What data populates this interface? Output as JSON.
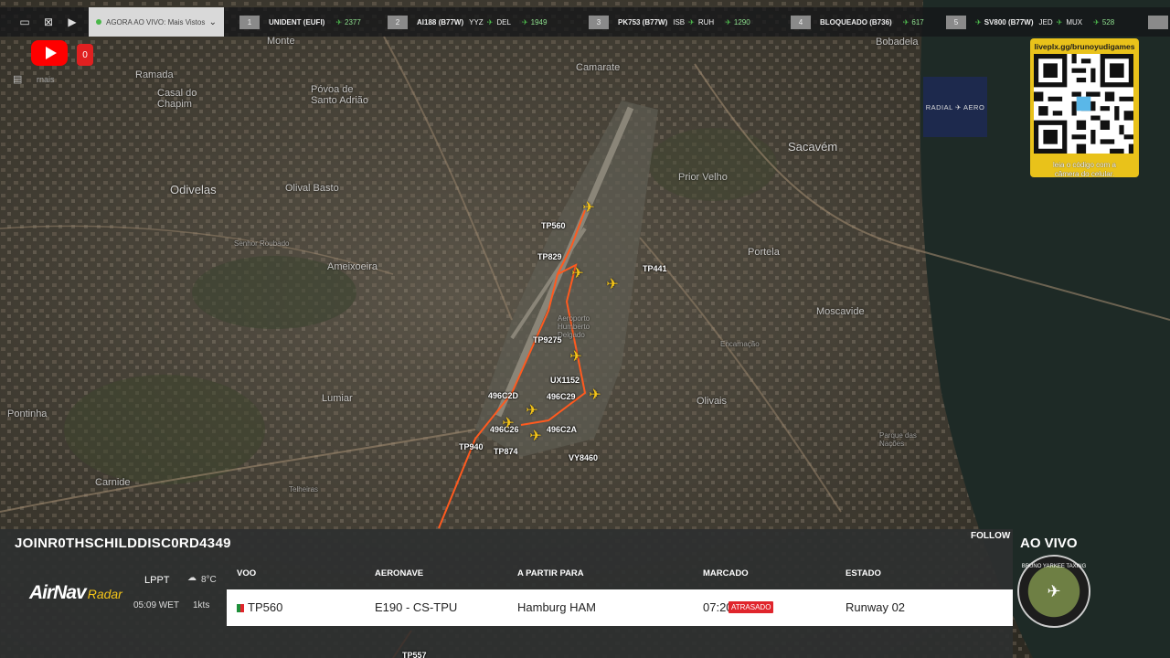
{
  "topbar": {
    "live_select_label": "AGORA AO VIVO: Mais Vistos",
    "items": [
      {
        "rank": "1",
        "route": "UNIDENT (EUFI)",
        "count": "2377"
      },
      {
        "rank": "2",
        "route": "AI188 (B77W)",
        "from": "YYZ",
        "to": "DEL",
        "count": "1949"
      },
      {
        "rank": "3",
        "route": "PK753 (B77W)",
        "from": "ISB",
        "to": "RUH",
        "count": "1290"
      },
      {
        "rank": "4",
        "route": "BLOQUEADO (B736)",
        "count": "617"
      },
      {
        "rank": "5",
        "route": "SV800 (B77W)",
        "from": "JED",
        "to": "MUX",
        "count": "528"
      }
    ]
  },
  "youtube_badge": "0",
  "side_text": "rnais",
  "qr": {
    "url": "liveplx.gg/brunoyudigames",
    "caption_line1": "leia o código com a",
    "caption_line2": "câmera do celular."
  },
  "radial_label": "RADIAL ✈ AERO",
  "map": {
    "places": {
      "monte": "Monte",
      "ramada": "Ramada",
      "casal_chapim": "Casal do Chapim",
      "povoa": "Póvoa de Santo Adrião",
      "camarate": "Camarate",
      "odivelas": "Odivelas",
      "olival": "Olival Basto",
      "sacavem": "Sacavém",
      "prior_velho": "Prior Velho",
      "ameixoeira": "Ameixoeira",
      "senhor_roubado": "Senhor Roubado",
      "portela": "Portela",
      "moscavide": "Moscavide",
      "encarnacao": "Encarnação",
      "lumiar": "Lumiar",
      "olivais": "Olivais",
      "parque": "Parque das Nações",
      "pontinha": "Pontinha",
      "carnide": "Carnide",
      "telheiras": "Telheiras",
      "aeroporto": "Aeroporto Humberto Delgado",
      "bobadela": "Bobadela"
    },
    "flights": [
      "TP560",
      "TP829",
      "TP441",
      "TP9275",
      "UX1152",
      "496C2D",
      "496C29",
      "496C26",
      "496C2A",
      "TP940",
      "TP874",
      "VY8460",
      "TP557"
    ]
  },
  "panel": {
    "title": "JOINR0THSCHILDDISC0RD4349",
    "follow_label": "FOLLOW",
    "brand": "AirNav",
    "brand_sub": "Radar",
    "airport": "LPPT",
    "time": "05:09 WET",
    "temp": "8°C",
    "wind": "1kts",
    "headers": {
      "voo": "VOO",
      "aeronave": "AERONAVE",
      "partir": "A PARTIR PARA",
      "marcado": "MARCADO",
      "estado": "ESTADO"
    },
    "row": {
      "flight": "TP560",
      "aircraft": "E190 - CS-TPU",
      "destination": "Hamburg HAM",
      "scheduled": "07:20",
      "delay": "ATRASADO",
      "status": "Runway 02"
    }
  },
  "ao_vivo": "AO VIVO",
  "logo_text": "BRUNO YARKEE TAXING",
  "colors": {
    "accent": "#f5c518",
    "track": "#ff5a1f",
    "delay": "#e0252c"
  }
}
